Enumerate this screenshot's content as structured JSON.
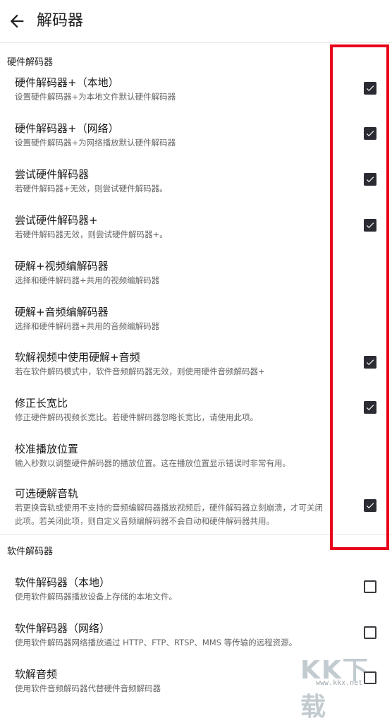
{
  "header": {
    "title": "解码器",
    "back_icon": "arrow-left-icon"
  },
  "sections": {
    "hw_title": "硬件解码器",
    "sw_title": "软件解码器"
  },
  "items": [
    {
      "title": "硬件解码器+（本地）",
      "subtitle": "设置硬件解码器+为本地文件默认硬件解码器",
      "checked": true
    },
    {
      "title": "硬件解码器+（网络）",
      "subtitle": "设置硬件解码器+为网络播放默认硬件解码器",
      "checked": true
    },
    {
      "title": "尝试硬件解码器",
      "subtitle": "若硬件解码器+无效，则尝试硬件解码器。",
      "checked": true
    },
    {
      "title": "尝试硬件解码器+",
      "subtitle": "若硬件解码器无效，则尝试硬件解码器+。",
      "checked": true
    },
    {
      "title": "硬解+视频编解码器",
      "subtitle": "选择和硬件解码器+共用的视频编解码器",
      "checked": null
    },
    {
      "title": "硬解+音频编解码器",
      "subtitle": "选择和硬件解码器+共用的音频编解码器",
      "checked": null
    },
    {
      "title": "软解视频中使用硬解+音频",
      "subtitle": "若在软件解码模式中，软件音频解码器无效，则使用硬件音频解码器+",
      "checked": true
    },
    {
      "title": "修正长宽比",
      "subtitle": "修正硬件解码视频长宽比。若硬件解码器忽略长宽比，请使用此项。",
      "checked": true
    },
    {
      "title": "校准播放位置",
      "subtitle": "输入秒数以调整硬件解码器的播放位置。这在播放位置显示错误时非常有用。",
      "checked": null
    },
    {
      "title": "可选硬解音轨",
      "subtitle": "若更换音轨或使用不支持的音频编解码器播放视频后，硬件解码器立刻崩溃，才可关闭此项。若关闭此项，则自定义音频编解码器不会自动和硬件解码器共用。",
      "checked": true
    },
    {
      "title": "软件解码器（本地）",
      "subtitle": "使用软件解码器播放设备上存储的本地文件。",
      "checked": false
    },
    {
      "title": "软件解码器（网络）",
      "subtitle": "使用软件解码器网络播放通过 HTTP、FTP、RTSP、MMS 等传输的远程资源。",
      "checked": false
    },
    {
      "title": "软解音频",
      "subtitle": "使用软件音频解码器代替硬件音频解码器",
      "checked": false
    }
  ],
  "watermark": {
    "text": "KK下载",
    "url": "www.kkx.net"
  },
  "colors": {
    "highlight": "#e8001b",
    "checkbox": "#2b2b33"
  }
}
